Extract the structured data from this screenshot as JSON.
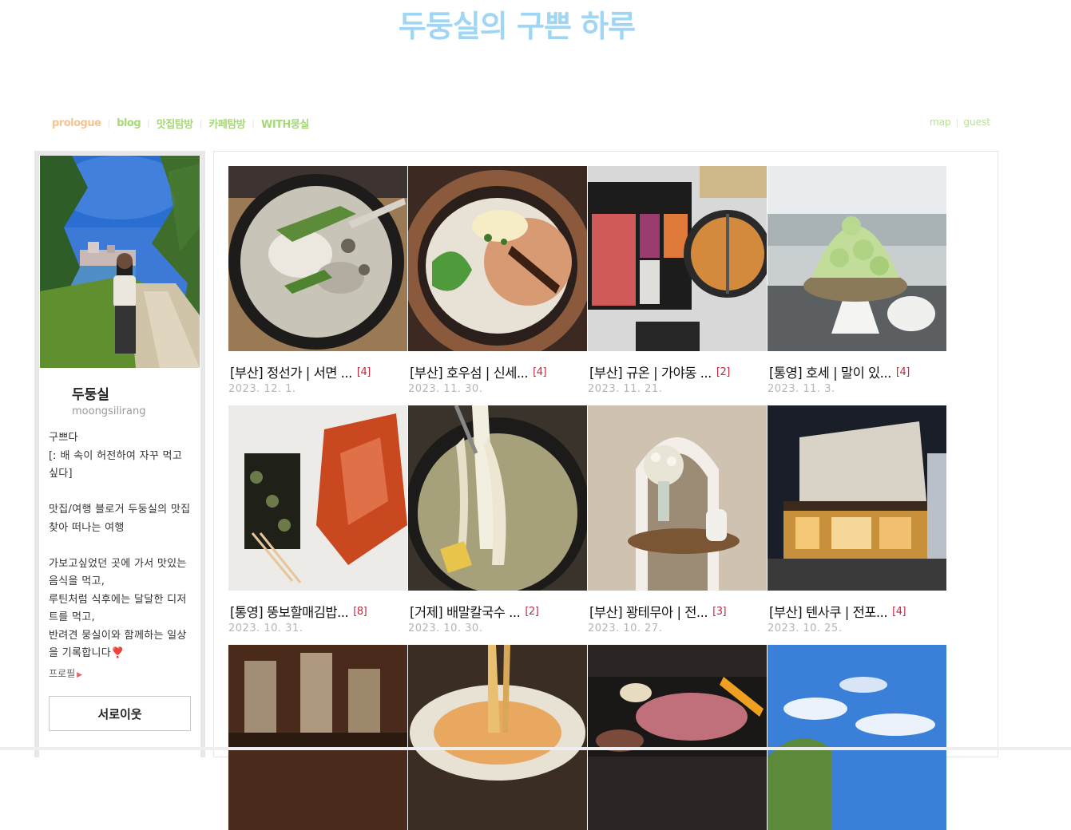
{
  "header": {
    "blog_title": "두둥실의 구쁜 하루"
  },
  "nav": {
    "left": [
      "prologue",
      "blog",
      "맛집탐방",
      "카페탐방",
      "WITH뭉실"
    ],
    "active": "prologue",
    "right": [
      "map",
      "guest"
    ]
  },
  "profile": {
    "nickname": "두둥실",
    "blog_id": "moongsilirang",
    "intro": "구쁘다\n[ː 배 속이 허전하여 자꾸 먹고 싶다]\n\n맛집/여행 블로거 두둥실의 맛집 찾아 떠나는 여행\n\n가보고싶었던 곳에 가서 맛있는 음식을 먹고,\n루틴처럼 식후에는 달달한 디저트를 먹고,\n반려견 뭉실이와 함께하는 일상을 기록합니다❣️",
    "profile_link": "프로필",
    "neighbor_button": "서로이웃"
  },
  "posts": [
    {
      "title": "[부산] 정선가 | 서면 ...",
      "comments": "[4]",
      "date": "2023. 12. 1.",
      "thumb": "gukbap"
    },
    {
      "title": "[부산] 호우섬 | 신세...",
      "comments": "[4]",
      "date": "2023. 11. 30.",
      "thumb": "claypot"
    },
    {
      "title": "[부산] 규온 | 가야동 ...",
      "comments": "[2]",
      "date": "2023. 11. 21.",
      "thumb": "hotpot"
    },
    {
      "title": "[통영] 호세 | 말이 있...",
      "comments": "[4]",
      "date": "2023. 11. 3.",
      "thumb": "bingsu"
    },
    {
      "title": "[통영] 뚱보할매김밥...",
      "comments": "[8]",
      "date": "2023. 10. 31.",
      "thumb": "gimbap"
    },
    {
      "title": "[거제] 배말칼국수 ...",
      "comments": "[2]",
      "date": "2023. 10. 30.",
      "thumb": "noodle"
    },
    {
      "title": "[부산] 꽝테무아 | 전...",
      "comments": "[3]",
      "date": "2023. 10. 27.",
      "thumb": "cafe"
    },
    {
      "title": "[부산] 텐사쿠 | 전포...",
      "comments": "[4]",
      "date": "2023. 10. 25.",
      "thumb": "building"
    },
    {
      "title": "",
      "comments": "",
      "date": "",
      "thumb": "bar"
    },
    {
      "title": "",
      "comments": "",
      "date": "",
      "thumb": "pasta"
    },
    {
      "title": "",
      "comments": "",
      "date": "",
      "thumb": "bbq"
    },
    {
      "title": "",
      "comments": "",
      "date": "",
      "thumb": "sky"
    }
  ]
}
